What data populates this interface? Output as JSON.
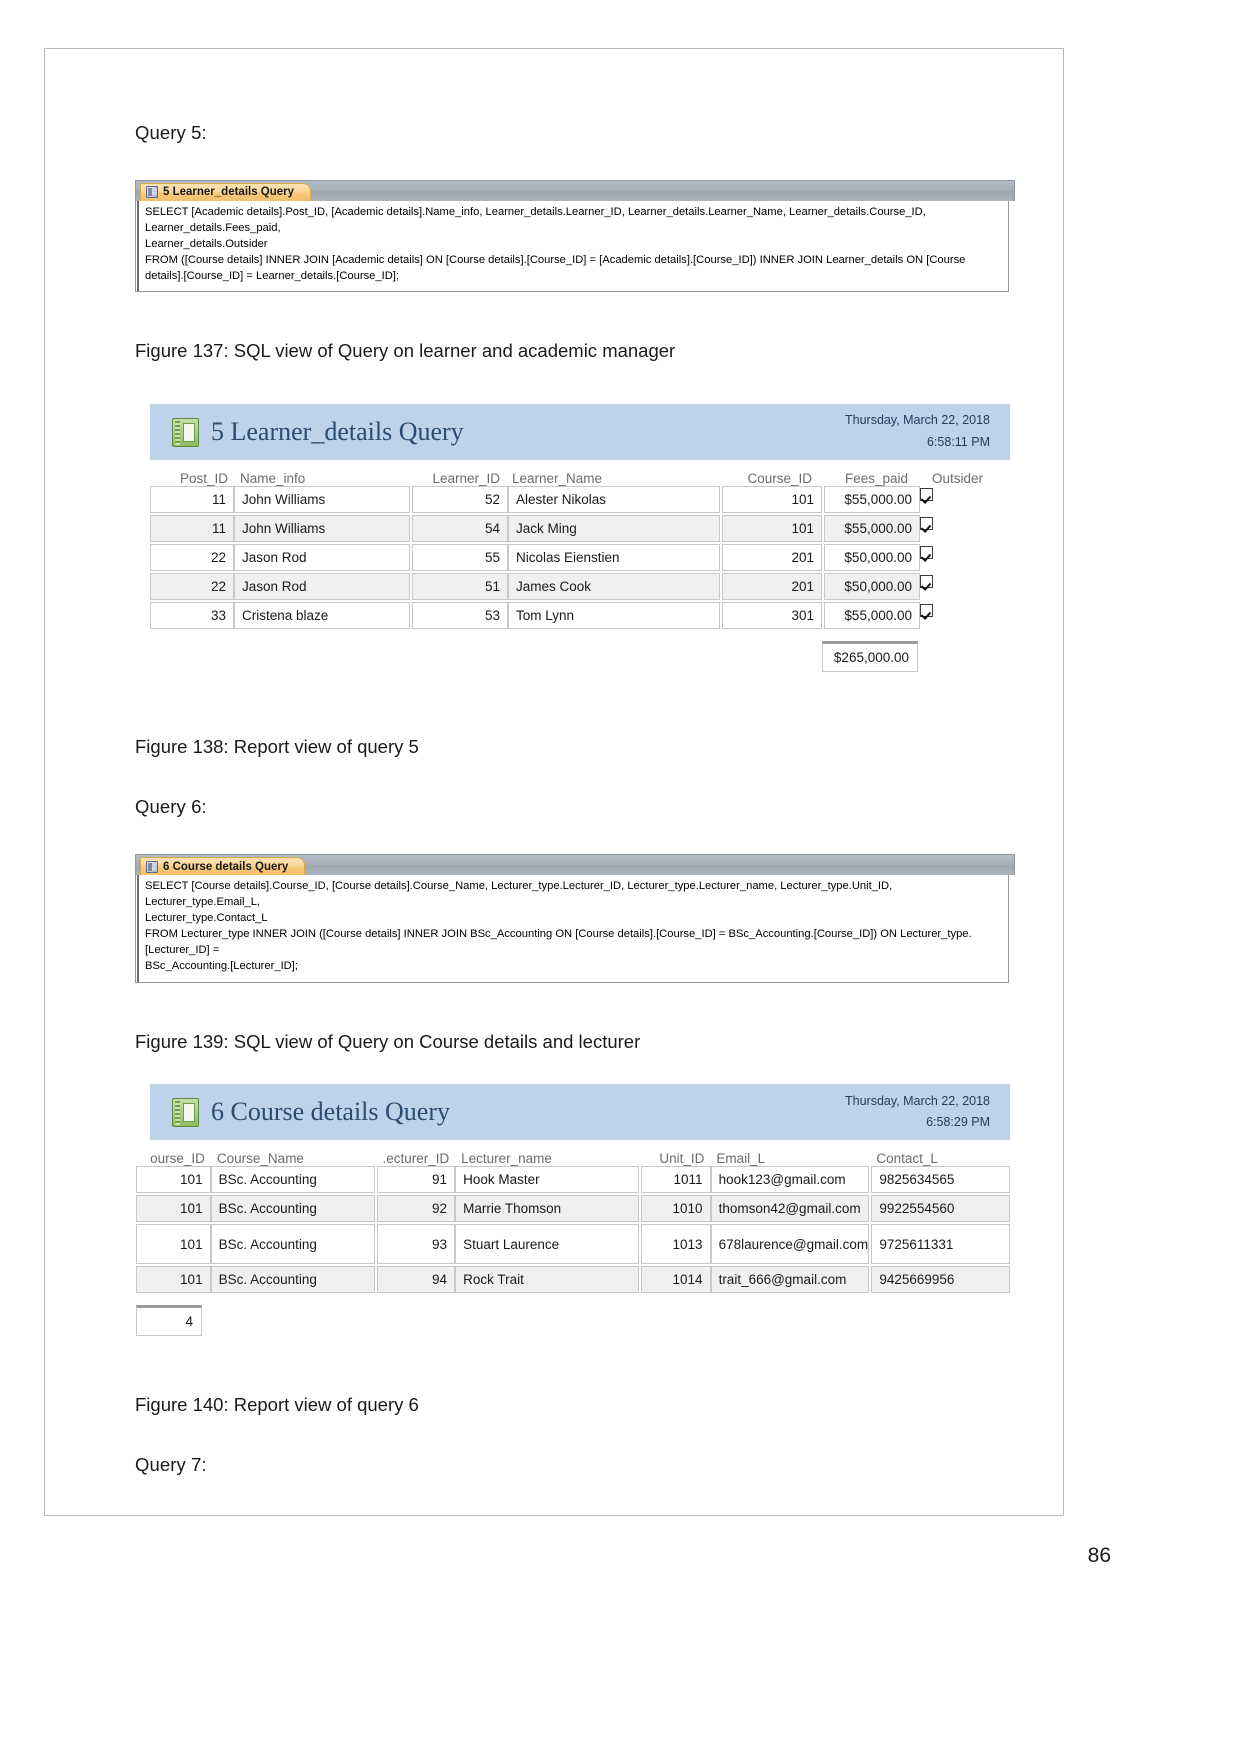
{
  "document": {
    "page_number": "86"
  },
  "sections": {
    "query5_label": "Query 5:",
    "query6_label": "Query 6:",
    "query7_label": "Query 7:"
  },
  "captions": {
    "fig137": "Figure 137: SQL view of Query on learner and academic manager",
    "fig138": "Figure 138: Report view of query 5",
    "fig139": "Figure 139: SQL view of Query on Course details and lecturer",
    "fig140": "Figure 140: Report view of query 6"
  },
  "sql_view_1": {
    "tab_label": "5 Learner_details Query",
    "tab_icon": "query-table-icon",
    "line1": "SELECT [Academic details].Post_ID, [Academic details].Name_info, Learner_details.Learner_ID, Learner_details.Learner_Name, Learner_details.Course_ID, Learner_details.Fees_paid,",
    "line2": "Learner_details.Outsider",
    "line3": "FROM ([Course details] INNER JOIN [Academic details] ON [Course details].[Course_ID] = [Academic details].[Course_ID]) INNER JOIN Learner_details ON [Course",
    "line4": "details].[Course_ID] = Learner_details.[Course_ID];"
  },
  "sql_view_2": {
    "tab_label": "6 Course details Query",
    "tab_icon": "query-table-icon",
    "line1": "SELECT [Course details].Course_ID, [Course details].Course_Name, Lecturer_type.Lecturer_ID, Lecturer_type.Lecturer_name, Lecturer_type.Unit_ID, Lecturer_type.Email_L,",
    "line2": "Lecturer_type.Contact_L",
    "line3": "FROM Lecturer_type INNER JOIN ([Course details] INNER JOIN BSc_Accounting ON [Course details].[Course_ID] = BSc_Accounting.[Course_ID]) ON Lecturer_type.[Lecturer_ID] =",
    "line4": "BSc_Accounting.[Lecturer_ID];"
  },
  "report1": {
    "icon": "report-book-icon",
    "title": "5 Learner_details Query",
    "date": "Thursday, March 22, 2018",
    "time": "6:58:11 PM",
    "columns": [
      "Post_ID",
      "Name_info",
      "Learner_ID",
      "Learner_Name",
      "Course_ID",
      "Fees_paid",
      "Outsider"
    ],
    "rows": [
      {
        "post_id": "11",
        "name_info": "John Williams",
        "learner_id": "52",
        "learner_name": "Alester Nikolas",
        "course_id": "101",
        "fees_paid": "$55,000.00",
        "outsider": true
      },
      {
        "post_id": "11",
        "name_info": "John Williams",
        "learner_id": "54",
        "learner_name": "Jack Ming",
        "course_id": "101",
        "fees_paid": "$55,000.00",
        "outsider": true
      },
      {
        "post_id": "22",
        "name_info": "Jason Rod",
        "learner_id": "55",
        "learner_name": "Nicolas Eienstien",
        "course_id": "201",
        "fees_paid": "$50,000.00",
        "outsider": true
      },
      {
        "post_id": "22",
        "name_info": "Jason Rod",
        "learner_id": "51",
        "learner_name": "James Cook",
        "course_id": "201",
        "fees_paid": "$50,000.00",
        "outsider": true
      },
      {
        "post_id": "33",
        "name_info": "Cristena blaze",
        "learner_id": "53",
        "learner_name": "Tom Lynn",
        "course_id": "301",
        "fees_paid": "$55,000.00",
        "outsider": true
      }
    ],
    "total": "$265,000.00"
  },
  "report2": {
    "icon": "report-book-icon",
    "title": "6 Course details Query",
    "date": "Thursday, March 22, 2018",
    "time": "6:58:29 PM",
    "columns": [
      "ourse_ID",
      "Course_Name",
      ".ecturer_ID",
      "Lecturer_name",
      "Unit_ID",
      "Email_L",
      "Contact_L"
    ],
    "rows": [
      {
        "course_id": "101",
        "course_name": "BSc. Accounting",
        "lecturer_id": "91",
        "lecturer_name": "Hook Master",
        "unit_id": "1011",
        "email_l": "hook123@gmail.com",
        "contact_l": "9825634565"
      },
      {
        "course_id": "101",
        "course_name": "BSc. Accounting",
        "lecturer_id": "92",
        "lecturer_name": "Marrie Thomson",
        "unit_id": "1010",
        "email_l": "thomson42@gmail.com",
        "contact_l": "9922554560"
      },
      {
        "course_id": "101",
        "course_name": "BSc. Accounting",
        "lecturer_id": "93",
        "lecturer_name": "Stuart Laurence",
        "unit_id": "1013",
        "email_l": "678laurence@gmail.com",
        "contact_l": "9725611331"
      },
      {
        "course_id": "101",
        "course_name": "BSc. Accounting",
        "lecturer_id": "94",
        "lecturer_name": "Rock Trait",
        "unit_id": "1014",
        "email_l": "trait_666@gmail.com",
        "contact_l": "9425669956"
      }
    ],
    "count": "4"
  },
  "colors": {
    "report_header_bg": "#bed3eb",
    "report_title": "#2c4a72",
    "tab_bg": "#f8c87c",
    "tabbar_bg": "#a7b0b9",
    "alt_row_bg": "#f0f0f0"
  }
}
